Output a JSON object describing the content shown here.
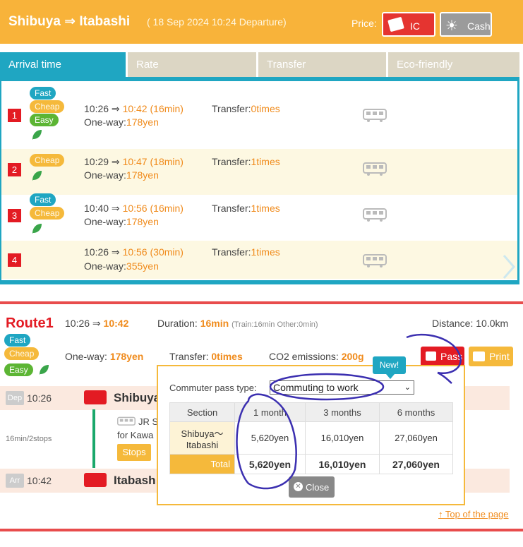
{
  "header": {
    "title": "Shibuya ⇒ Itabashi",
    "departure": "( 18 Sep 2024 10:24 Departure)",
    "price_label": "Price:",
    "ic_label": "IC",
    "cash_label": "Cash"
  },
  "tabs": [
    {
      "label": "Arrival time",
      "active": true
    },
    {
      "label": "Rate",
      "active": false
    },
    {
      "label": "Transfer",
      "active": false
    },
    {
      "label": "Eco-friendly",
      "active": false
    }
  ],
  "results": [
    {
      "num": "1",
      "badges": [
        "Fast",
        "Cheap",
        "Easy"
      ],
      "eco": true,
      "depart": "10:26",
      "arrive": "10:42",
      "duration": "(16min)",
      "transfer_label": "Transfer:",
      "transfers": "0times",
      "fare_label": "One-way:",
      "fare": "178yen"
    },
    {
      "num": "2",
      "badges": [
        "Cheap"
      ],
      "eco": true,
      "depart": "10:29",
      "arrive": "10:47",
      "duration": "(18min)",
      "transfer_label": "Transfer:",
      "transfers": "1times",
      "fare_label": "One-way:",
      "fare": "178yen"
    },
    {
      "num": "3",
      "badges": [
        "Fast",
        "Cheap"
      ],
      "eco": true,
      "depart": "10:40",
      "arrive": "10:56",
      "duration": "(16min)",
      "transfer_label": "Transfer:",
      "transfers": "1times",
      "fare_label": "One-way:",
      "fare": "178yen"
    },
    {
      "num": "4",
      "badges": [],
      "eco": false,
      "depart": "10:26",
      "arrive": "10:56",
      "duration": "(30min)",
      "transfer_label": "Transfer:",
      "transfers": "1times",
      "fare_label": "One-way:",
      "fare": "355yen"
    }
  ],
  "route1": {
    "title": "Route1",
    "depart": "10:26 ⇒",
    "arrive": "10:42",
    "duration_label": "Duration:",
    "duration": "16min",
    "duration_detail": "(Train:16min Other:0min)",
    "distance": "Distance: 10.0km",
    "badges": [
      "Fast",
      "Cheap",
      "Easy"
    ],
    "oneway_label": "One-way:",
    "oneway": "178yen",
    "transfer_label": "Transfer:",
    "transfers": "0times",
    "co2_label": "CO2 emissions:",
    "co2": "200g",
    "pass_label": "Pass",
    "print_label": "Print",
    "dep_tag": "Dep",
    "dep_time": "10:26",
    "dep_station": "Shibuya",
    "travel_info": "16min/2stops",
    "line_name": "JR S",
    "line_for": "for Kawa",
    "stops_label": "Stops",
    "arr_tag": "Arr",
    "arr_time": "10:42",
    "arr_station": "Itabash"
  },
  "popup": {
    "new_label": "New!",
    "type_label": "Commuter pass type:",
    "type_value": "Commuting to work",
    "table": {
      "headers": [
        "Section",
        "1 month",
        "3 months",
        "6 months"
      ],
      "section": "Shibuya～ Itabashi",
      "row": [
        "5,620yen",
        "16,010yen",
        "27,060yen"
      ],
      "total_label": "Total",
      "total": [
        "5,620yen",
        "16,010yen",
        "27,060yen"
      ]
    },
    "close_label": "Close"
  },
  "footer": {
    "top_link": "Top of the page"
  },
  "colors": {
    "header": "#f8b33a",
    "tab_active": "#1fa6c2",
    "accent_red": "#e31b23",
    "accent_orange": "#f08b1c"
  }
}
